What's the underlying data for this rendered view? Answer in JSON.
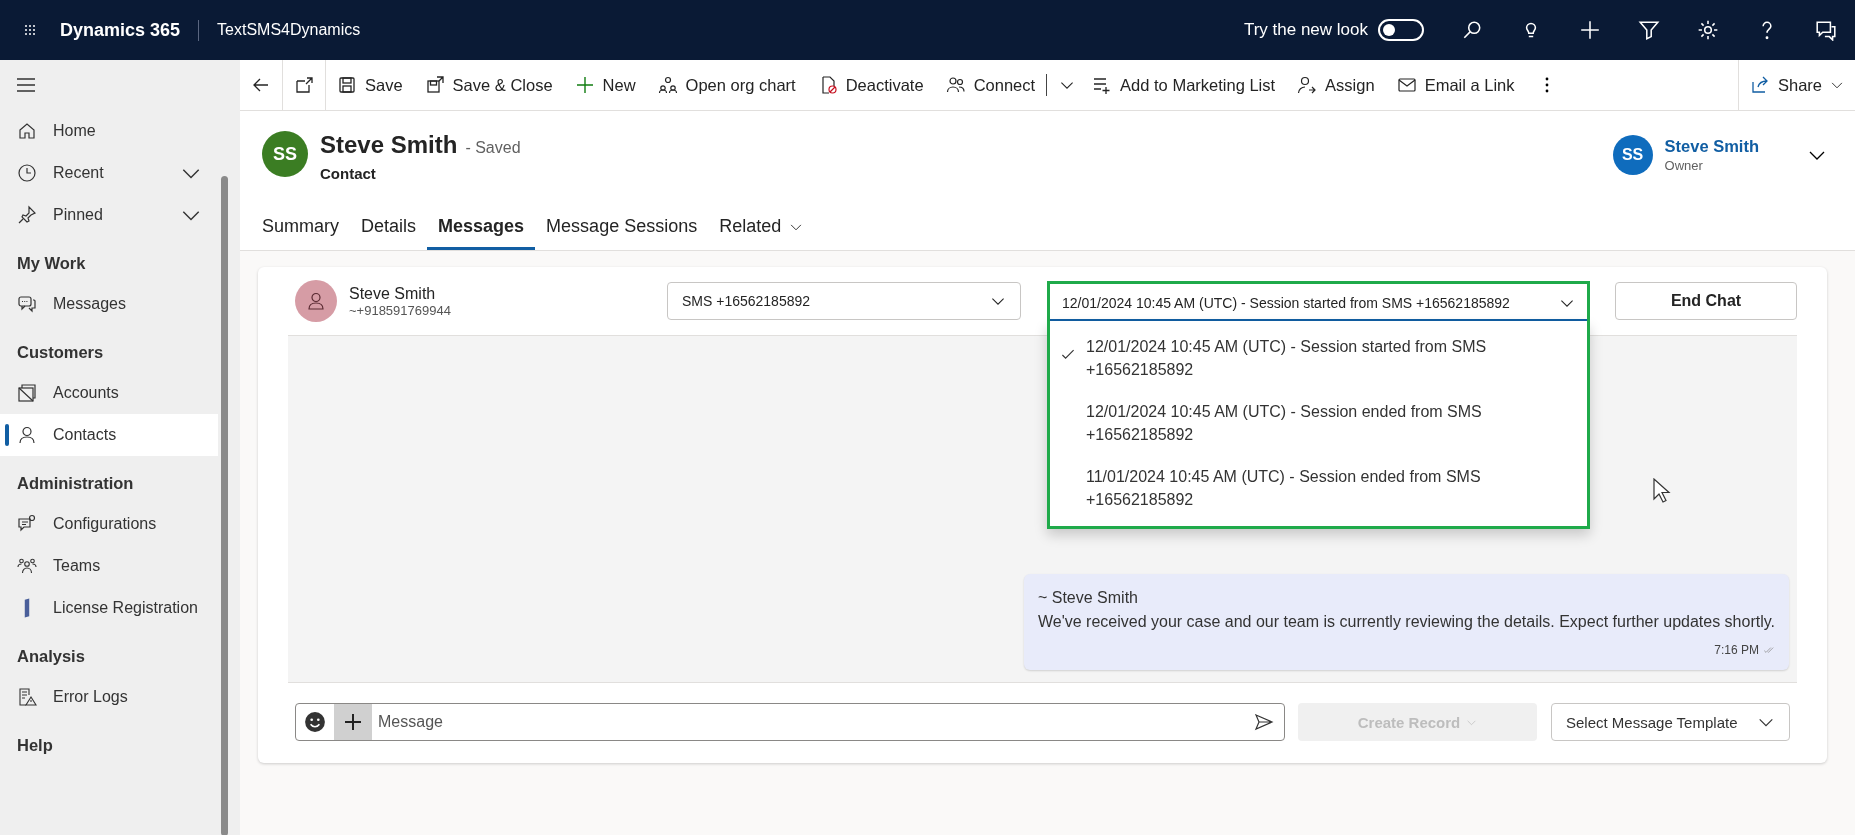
{
  "top_bar": {
    "app_name": "Dynamics 365",
    "app_title": "TextSMS4Dynamics",
    "new_look": {
      "label": "Try the new look",
      "on": false
    }
  },
  "toolbar": {
    "items": [
      {
        "label": "Save",
        "has_menu": false
      },
      {
        "label": "Save & Close",
        "has_menu": false
      },
      {
        "label": "New",
        "has_menu": false
      },
      {
        "label": "Open org chart",
        "has_menu": false
      },
      {
        "label": "Deactivate",
        "has_menu": false
      },
      {
        "label": "Connect",
        "has_menu": true
      },
      {
        "label": "Add to Marketing List",
        "has_menu": false
      },
      {
        "label": "Assign",
        "has_menu": false
      },
      {
        "label": "Email a Link",
        "has_menu": false
      }
    ],
    "share": "Share"
  },
  "sidebar": {
    "items": [
      {
        "label": "Home",
        "expandable": false
      },
      {
        "label": "Recent",
        "expandable": true
      },
      {
        "label": "Pinned",
        "expandable": true
      }
    ],
    "groups": [
      {
        "title": "My Work",
        "items": [
          {
            "label": "Messages",
            "selected": false
          }
        ]
      },
      {
        "title": "Customers",
        "items": [
          {
            "label": "Accounts",
            "selected": false
          },
          {
            "label": "Contacts",
            "selected": true
          }
        ]
      },
      {
        "title": "Administration",
        "items": [
          {
            "label": "Configurations",
            "selected": false
          },
          {
            "label": "Teams",
            "selected": false
          },
          {
            "label": "License Registration",
            "selected": false
          }
        ]
      },
      {
        "title": "Analysis",
        "items": [
          {
            "label": "Error Logs",
            "selected": false
          }
        ]
      },
      {
        "title": "Help"
      }
    ]
  },
  "record": {
    "initials": "SS",
    "name": "Steve Smith",
    "status": "- Saved",
    "entity": "Contact",
    "owner": {
      "initials": "SS",
      "name": "Steve Smith",
      "role": "Owner"
    }
  },
  "tabs": [
    {
      "label": "Summary",
      "selected": false,
      "has_menu": false
    },
    {
      "label": "Details",
      "selected": false,
      "has_menu": false
    },
    {
      "label": "Messages",
      "selected": true,
      "has_menu": false
    },
    {
      "label": "Message Sessions",
      "selected": false,
      "has_menu": false
    },
    {
      "label": "Related",
      "selected": false,
      "has_menu": true
    }
  ],
  "chat": {
    "contact": {
      "name": "Steve Smith",
      "phone": "~+918591769944"
    },
    "channel": "SMS +16562185892",
    "session": {
      "value": "12/01/2024 10:45 AM (UTC) - Session started from SMS +16562185892",
      "expanded": true,
      "options": [
        {
          "label": "12/01/2024 10:45 AM (UTC) - Session started from SMS +16562185892",
          "selected": true
        },
        {
          "label": "12/01/2024 10:45 AM (UTC) - Session ended from SMS +16562185892",
          "selected": false
        },
        {
          "label": "11/01/2024 10:45 AM (UTC) - Session ended from SMS +16562185892",
          "selected": false
        }
      ]
    },
    "end_chat": "End Chat",
    "messages": [
      {
        "sender": "~ Steve Smith",
        "text": "We've received your case and our team is currently reviewing the details. Expect further updates shortly.",
        "time": "7:16 PM"
      }
    ],
    "composer": {
      "placeholder": "Message",
      "create_record": {
        "label": "Create Record",
        "disabled": true
      },
      "template": "Select Message Template"
    }
  }
}
